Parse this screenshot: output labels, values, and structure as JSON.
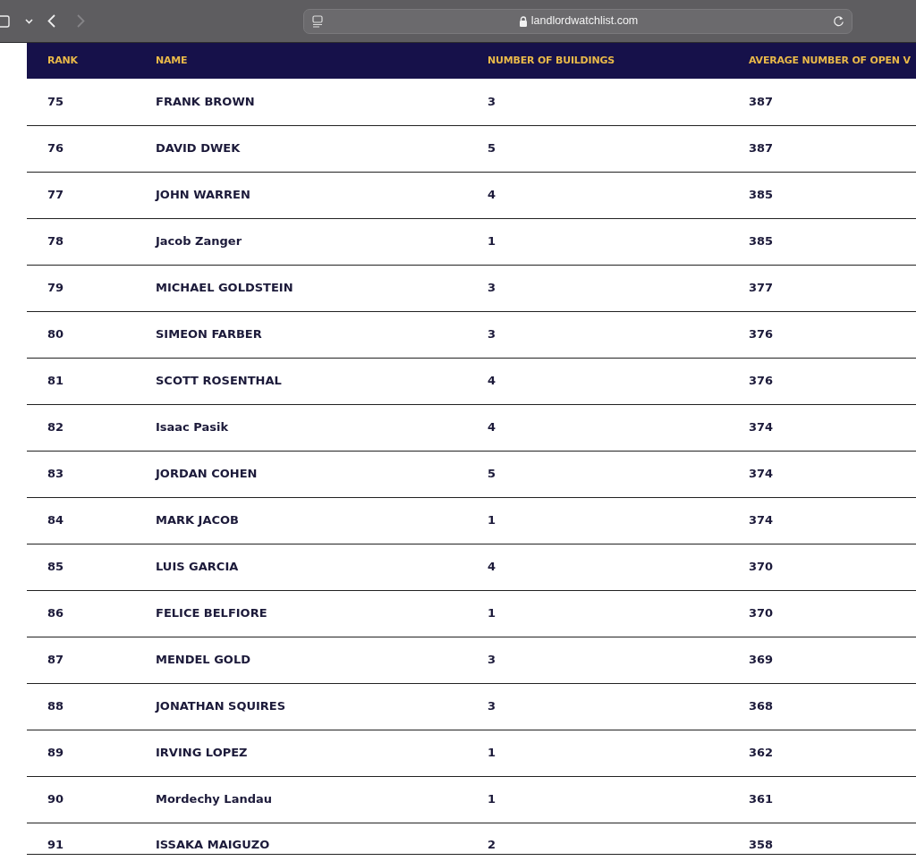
{
  "browser": {
    "url": "landlordwatchlist.com"
  },
  "table": {
    "columns": [
      "RANK",
      "NAME",
      "NUMBER OF BUILDINGS",
      "AVERAGE NUMBER OF OPEN V"
    ],
    "rows": [
      [
        "75",
        "FRANK BROWN",
        "3",
        "387"
      ],
      [
        "76",
        "DAVID DWEK",
        "5",
        "387"
      ],
      [
        "77",
        "JOHN WARREN",
        "4",
        "385"
      ],
      [
        "78",
        "Jacob Zanger",
        "1",
        "385"
      ],
      [
        "79",
        "MICHAEL GOLDSTEIN",
        "3",
        "377"
      ],
      [
        "80",
        "SIMEON FARBER",
        "3",
        "376"
      ],
      [
        "81",
        "SCOTT ROSENTHAL",
        "4",
        "376"
      ],
      [
        "82",
        "Isaac Pasik",
        "4",
        "374"
      ],
      [
        "83",
        "JORDAN COHEN",
        "5",
        "374"
      ],
      [
        "84",
        "MARK JACOB",
        "1",
        "374"
      ],
      [
        "85",
        "LUIS GARCIA",
        "4",
        "370"
      ],
      [
        "86",
        "FELICE BELFIORE",
        "1",
        "370"
      ],
      [
        "87",
        "MENDEL GOLD",
        "3",
        "369"
      ],
      [
        "88",
        "JONATHAN SQUIRES",
        "3",
        "368"
      ],
      [
        "89",
        "IRVING LOPEZ",
        "1",
        "362"
      ],
      [
        "90",
        "Mordechy Landau",
        "1",
        "361"
      ],
      [
        "91",
        "ISSAKA MAIGUZO",
        "2",
        "358"
      ]
    ]
  }
}
